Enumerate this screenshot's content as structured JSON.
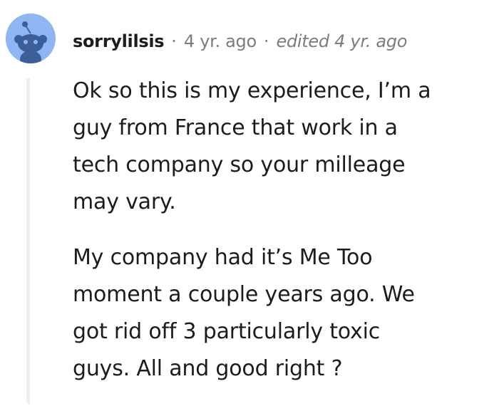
{
  "comment": {
    "author": "sorrylilsis",
    "separator_1": "·",
    "timestamp": "4 yr. ago",
    "separator_2": "·",
    "edited": "edited 4 yr. ago",
    "avatar_icon": "reddit-snoo-avatar-icon",
    "avatar_color": "#8fb6f2",
    "paragraphs": [
      {
        "lines": [
          "Ok so this is my experience, I’m a",
          "guy from France that work in a",
          "tech company so your milleage",
          "may vary."
        ]
      },
      {
        "lines": [
          "My company had it’s Me Too",
          "moment a couple years ago. We",
          "got rid off 3 particularly toxic",
          "guys. All and good right ?"
        ]
      }
    ]
  }
}
